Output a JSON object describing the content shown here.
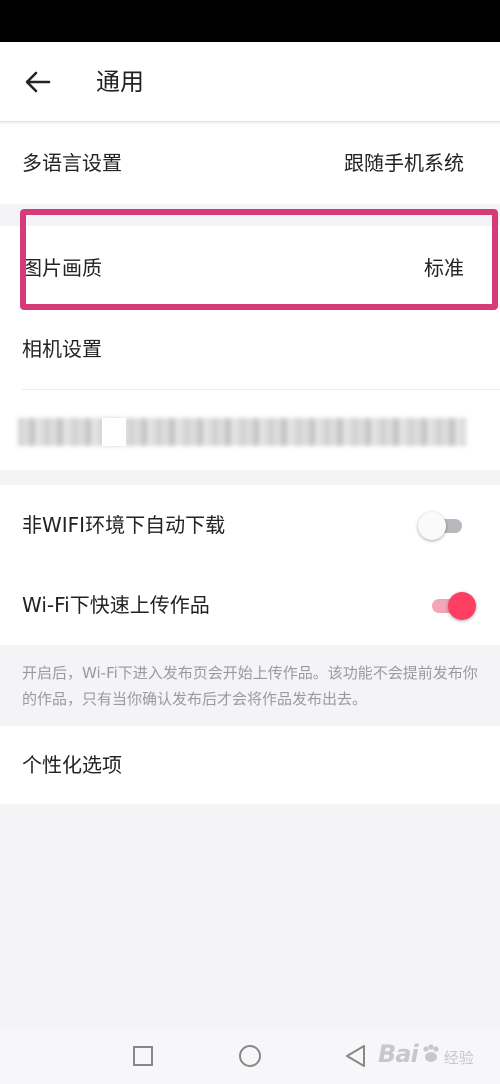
{
  "header": {
    "title": "通用"
  },
  "settings": {
    "language": {
      "label": "多语言设置",
      "value": "跟随手机系统"
    },
    "image_quality": {
      "label": "图片画质",
      "value": "标准"
    },
    "camera": {
      "label": "相机设置"
    },
    "non_wifi_download": {
      "label": "非WIFI环境下自动下载",
      "enabled": false
    },
    "wifi_upload": {
      "label": "Wi-Fi下快速上传作品",
      "enabled": true
    },
    "wifi_upload_hint": "开启后，Wi-Fi下进入发布页会开始上传作品。该功能不会提前发布你的作品，只有当你确认发布后才会将作品发布出去。",
    "personalization": {
      "label": "个性化选项"
    }
  },
  "watermark": {
    "brand": "Bai",
    "sub": "经验"
  },
  "colors": {
    "highlight": "#d63a7a",
    "toggle_on": "#fe3e62",
    "toggle_on_track": "#f3a6b7",
    "toggle_off_track": "#b9b9bd"
  }
}
